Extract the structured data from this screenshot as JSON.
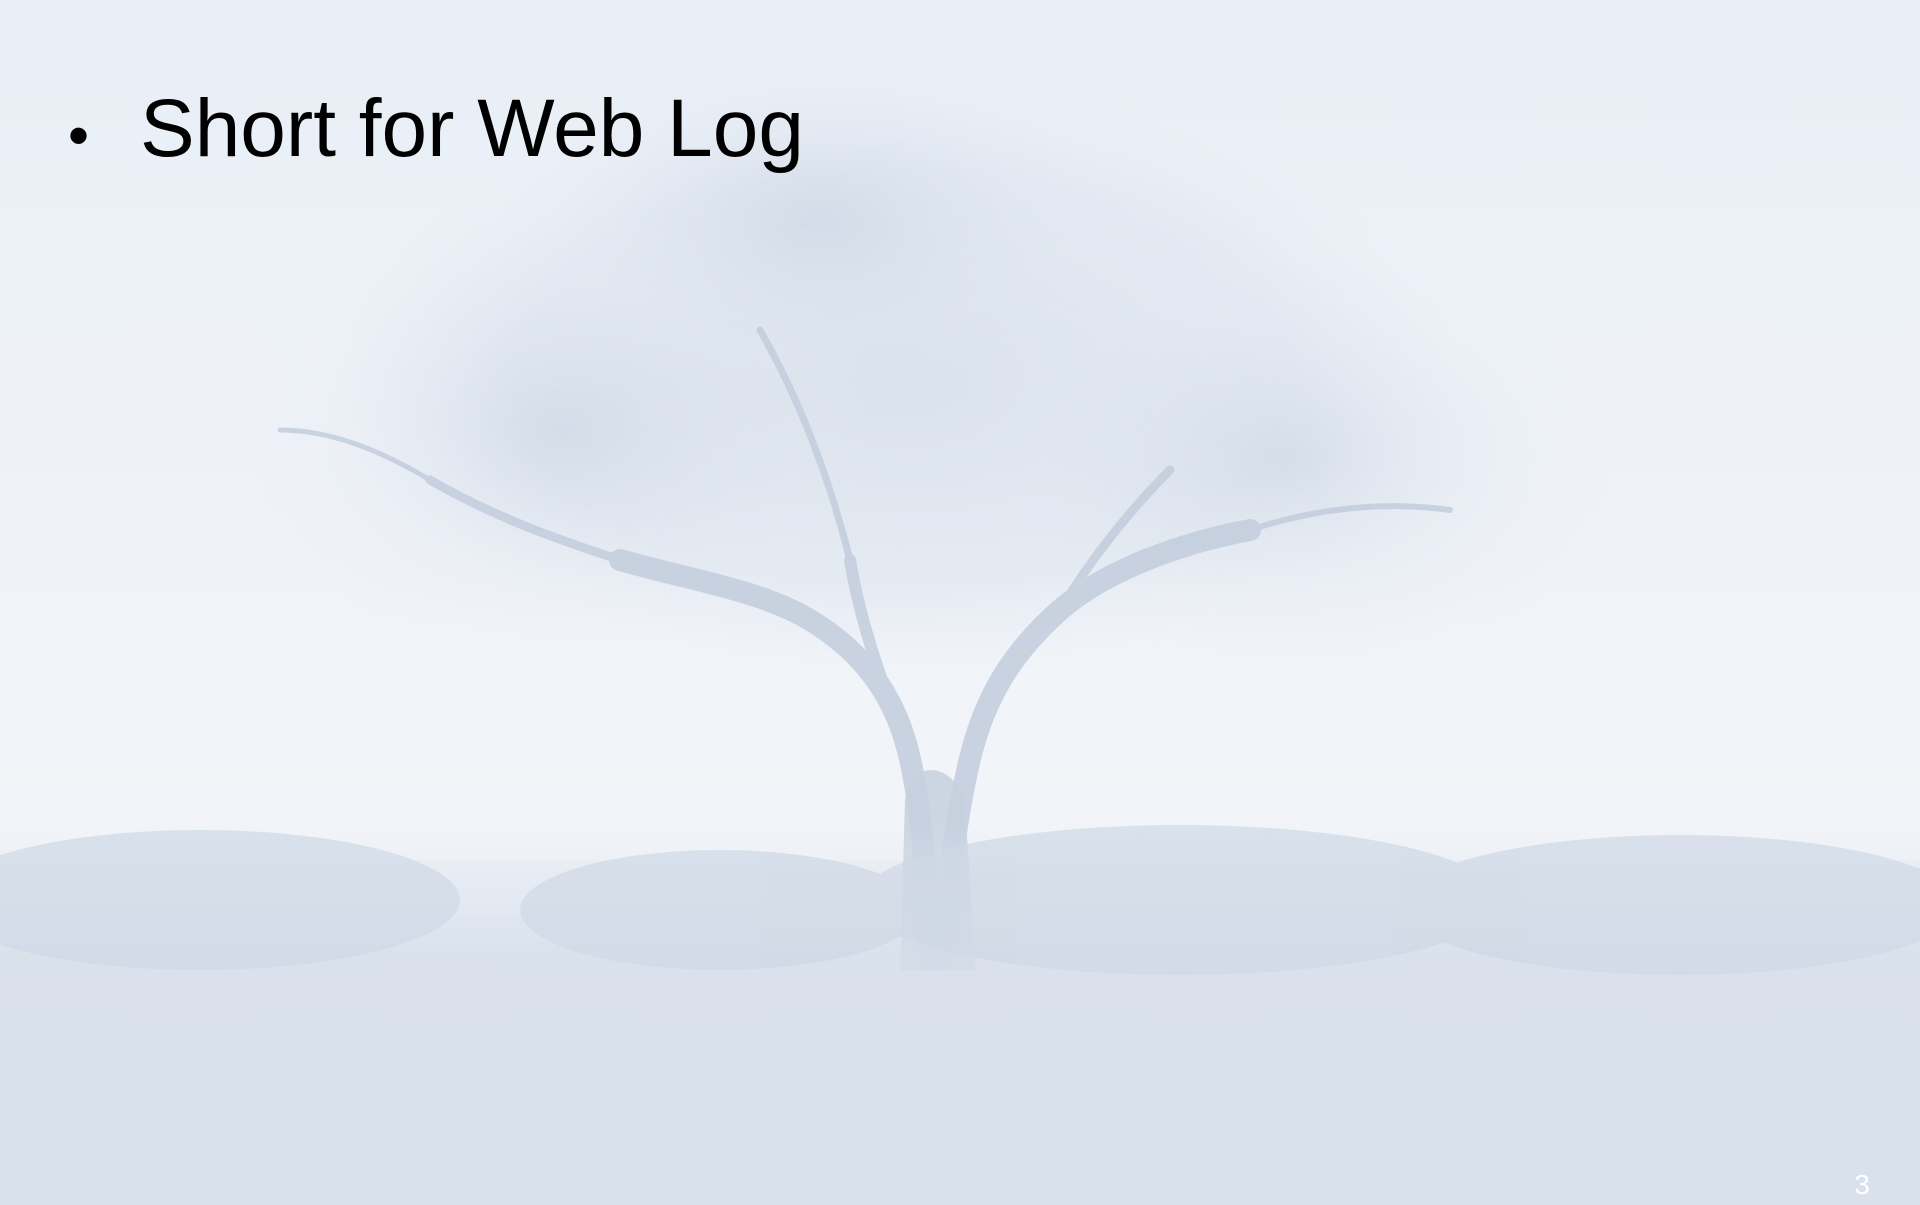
{
  "slide": {
    "bullets": [
      {
        "marker": "•",
        "text": "Short for Web Log"
      }
    ],
    "page_number": "3",
    "background_image": "misty-tree-field"
  },
  "colors": {
    "text": "#000000",
    "background": "#eef2f8",
    "page_number": "#ffffff"
  }
}
